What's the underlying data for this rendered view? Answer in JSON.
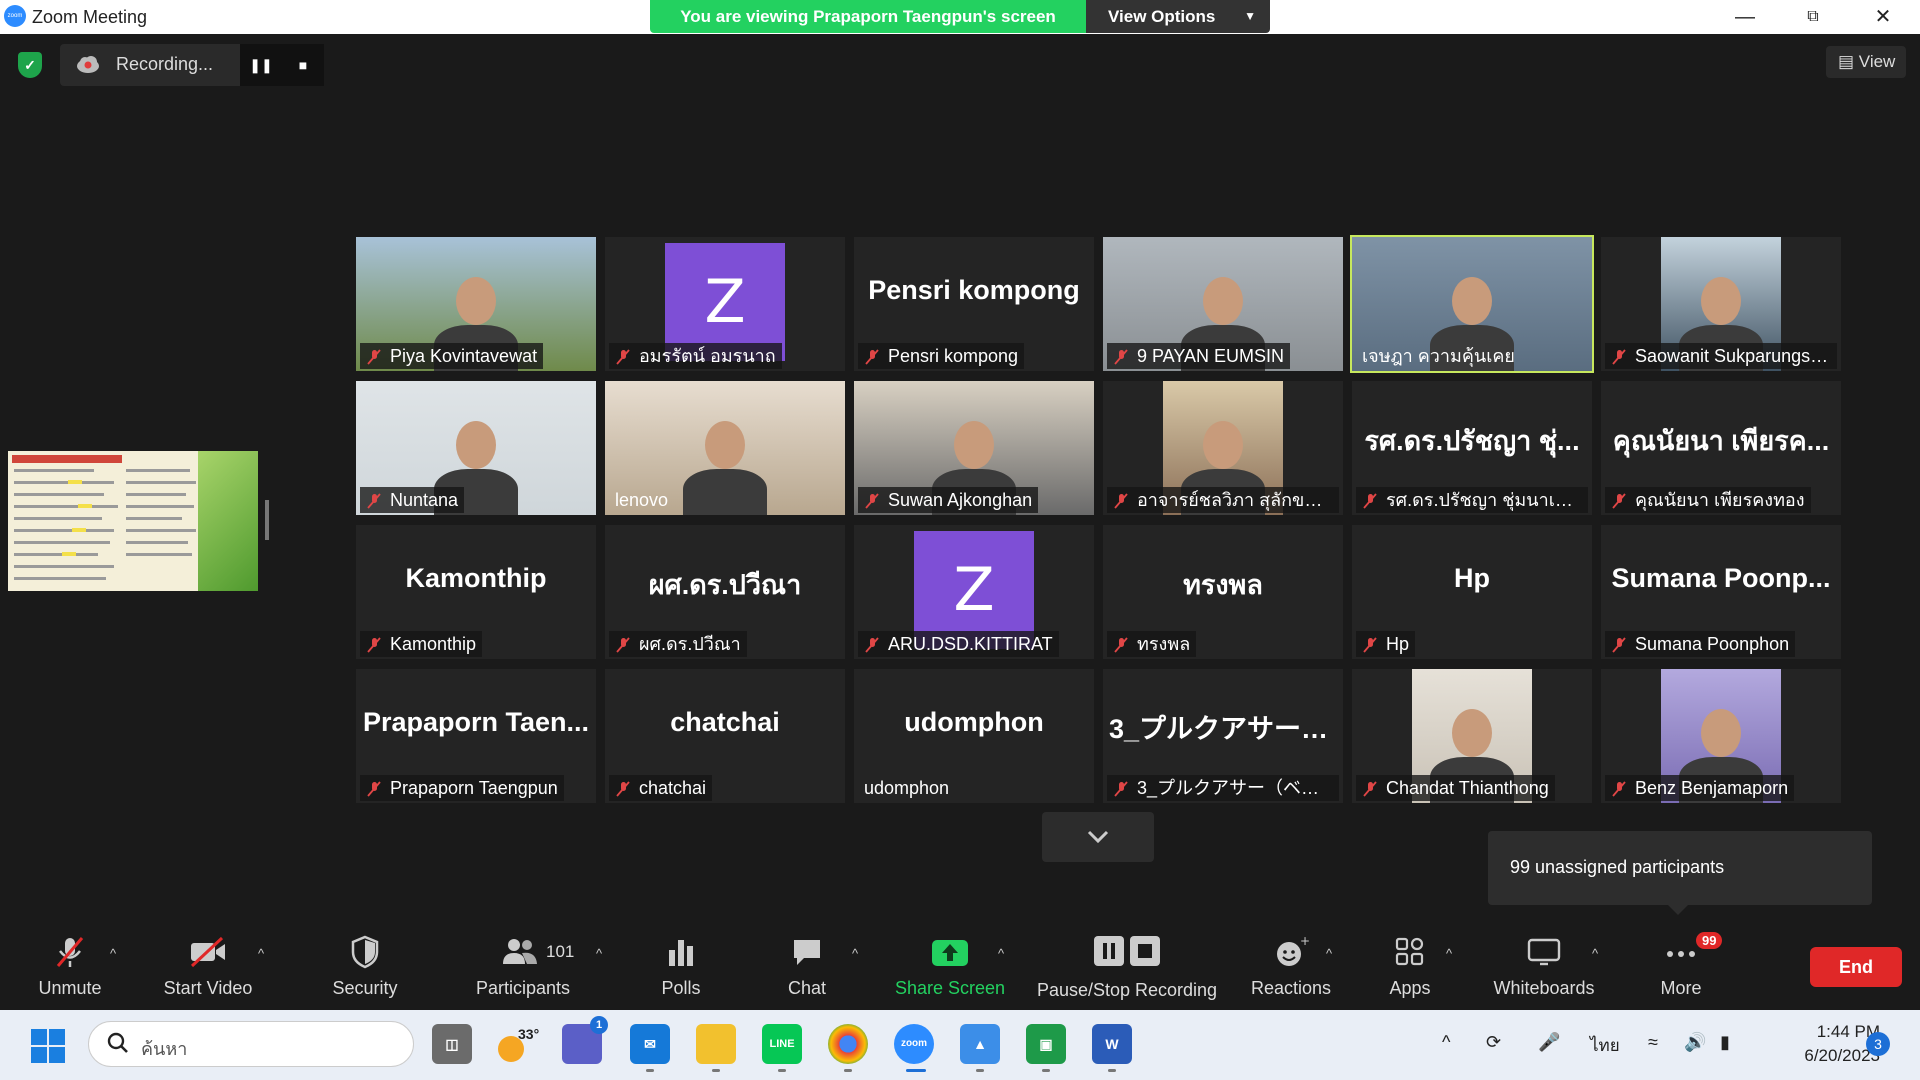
{
  "window": {
    "title": "Zoom Meeting",
    "app_logo_text": "zoom",
    "viewing_banner": "You are viewing Prapaporn Taengpun's screen",
    "view_options_label": "View Options"
  },
  "top_strip": {
    "recording_label": "Recording...",
    "view_label": "View"
  },
  "gallery": {
    "tiles": [
      {
        "name": "Piya Kovintavewat",
        "kind": "photo",
        "muted": true
      },
      {
        "name": "อมรรัตน์ อมรนาถ",
        "kind": "avatar",
        "avatar_letter": "Z",
        "muted": true
      },
      {
        "name": "Pensri kompong",
        "kind": "text",
        "big": "Pensri kompong",
        "muted": true
      },
      {
        "name": "9 PAYAN EUMSIN",
        "kind": "photo",
        "muted": true
      },
      {
        "name": "เจษฎา ความคุ้นเคย",
        "kind": "photo",
        "muted": false,
        "active": true
      },
      {
        "name": "Saowanit Sukparungse...",
        "kind": "photo",
        "muted": true
      },
      {
        "name": "Nuntana",
        "kind": "photo",
        "muted": true
      },
      {
        "name": "lenovo",
        "kind": "photo",
        "muted": false
      },
      {
        "name": "Suwan Ajkonghan",
        "kind": "photo",
        "muted": true
      },
      {
        "name": "อาจารย์ชลวิภา สุลักขณานุ...",
        "kind": "photo",
        "muted": true
      },
      {
        "name": "รศ.ดร.ปรัชญา ชุ่มนาเสียว",
        "kind": "text",
        "big": "รศ.ดร.ปรัชญา ชุ่...",
        "muted": true
      },
      {
        "name": "คุณนัยนา เพียรคงทอง",
        "kind": "text",
        "big": "คุณนัยนา เพียรค...",
        "muted": true
      },
      {
        "name": "Kamonthip",
        "kind": "text",
        "big": "Kamonthip",
        "muted": true
      },
      {
        "name": "ผศ.ดร.ปวีณา",
        "kind": "text",
        "big": "ผศ.ดร.ปวีณา",
        "muted": true
      },
      {
        "name": "ARU.DSD.KITTIRAT",
        "kind": "avatar",
        "avatar_letter": "Z",
        "muted": true
      },
      {
        "name": "ทรงพล",
        "kind": "text",
        "big": "ทรงพล",
        "muted": true
      },
      {
        "name": "Hp",
        "kind": "text",
        "big": "Hp",
        "muted": true
      },
      {
        "name": "Sumana Poonphon",
        "kind": "text",
        "big": "Sumana  Poonp...",
        "muted": true
      },
      {
        "name": "Prapaporn Taengpun",
        "kind": "text",
        "big": "Prapaporn  Taen...",
        "muted": true
      },
      {
        "name": "chatchai",
        "kind": "text",
        "big": "chatchai",
        "muted": true
      },
      {
        "name": "udomphon",
        "kind": "text",
        "big": "udomphon",
        "muted": false
      },
      {
        "name": "3_プルクアサー（ベンツ）ト...",
        "kind": "text",
        "big": "3_プルクアサー（...",
        "muted": true
      },
      {
        "name": "Chandat Thianthong",
        "kind": "photo",
        "muted": true
      },
      {
        "name": "Benz Benjamaporn",
        "kind": "photo",
        "muted": true
      }
    ]
  },
  "tooltip": {
    "text": "99 unassigned participants"
  },
  "toolbar": {
    "unmute": "Unmute",
    "start_video": "Start Video",
    "security": "Security",
    "participants": "Participants",
    "participant_count": "101",
    "polls": "Polls",
    "chat": "Chat",
    "share_screen": "Share Screen",
    "pause_stop_recording": "Pause/Stop Recording",
    "reactions": "Reactions",
    "apps": "Apps",
    "whiteboards": "Whiteboards",
    "more": "More",
    "more_badge": "99",
    "end": "End",
    "accent_green": "#23d160",
    "end_red": "#e02828"
  },
  "taskbar": {
    "search_placeholder": "ค้นหา",
    "weather_temp": "33°",
    "teams_badge": "1",
    "language": "ไทย",
    "time": "1:44 PM",
    "date": "6/20/2023",
    "notification_count": "3"
  }
}
